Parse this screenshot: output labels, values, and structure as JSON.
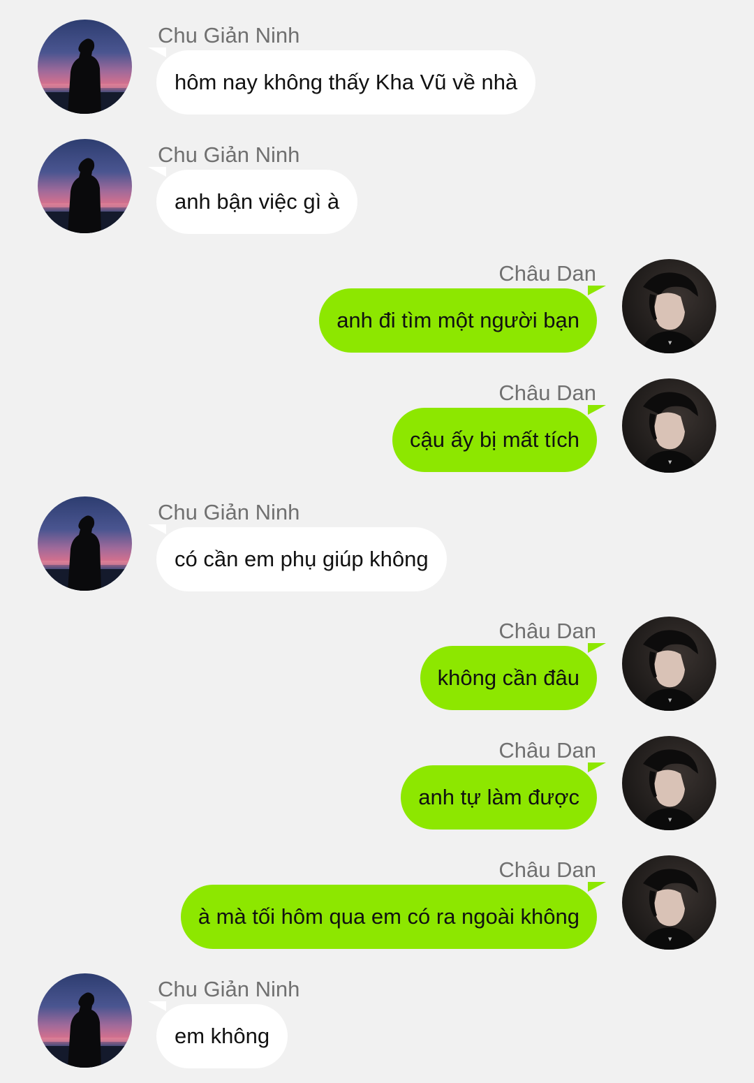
{
  "colors": {
    "background": "#f1f1f1",
    "incoming_bubble": "#ffffff",
    "outgoing_bubble": "#8de700",
    "name_text": "#707070",
    "message_text": "#111111"
  },
  "messages": [
    {
      "sender": "Chu Giản Ninh",
      "side": "left",
      "text": "hôm nay không thấy Kha Vũ về nhà",
      "avatar": "silhouette-sunset-avatar"
    },
    {
      "sender": "Chu Giản Ninh",
      "side": "left",
      "text": "anh bận việc gì à",
      "avatar": "silhouette-sunset-avatar"
    },
    {
      "sender": "Châu Dan",
      "side": "right",
      "text": "anh đi tìm một người bạn",
      "avatar": "dark-portrait-avatar"
    },
    {
      "sender": "Châu Dan",
      "side": "right",
      "text": "cậu ấy bị mất tích",
      "avatar": "dark-portrait-avatar"
    },
    {
      "sender": "Chu Giản Ninh",
      "side": "left",
      "text": "có cần em phụ giúp không",
      "avatar": "silhouette-sunset-avatar"
    },
    {
      "sender": "Châu Dan",
      "side": "right",
      "text": "không cần đâu",
      "avatar": "dark-portrait-avatar"
    },
    {
      "sender": "Châu Dan",
      "side": "right",
      "text": "anh tự làm được",
      "avatar": "dark-portrait-avatar"
    },
    {
      "sender": "Châu Dan",
      "side": "right",
      "text": "à mà tối hôm qua em có ra ngoài không",
      "avatar": "dark-portrait-avatar"
    },
    {
      "sender": "Chu Giản Ninh",
      "side": "left",
      "text": "em không",
      "avatar": "silhouette-sunset-avatar"
    }
  ]
}
